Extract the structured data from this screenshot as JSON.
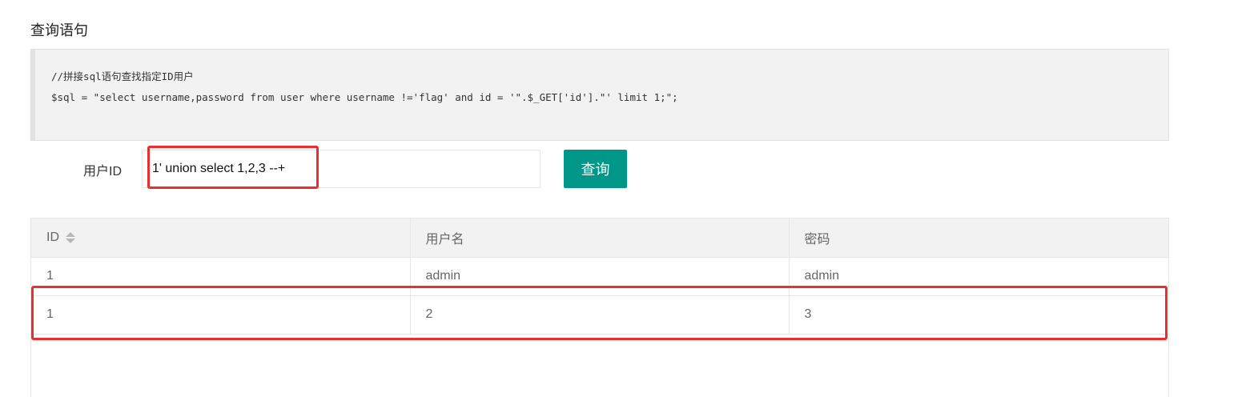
{
  "section": {
    "title": "查询语句"
  },
  "code": {
    "lines": [
      "//拼接sql语句查找指定ID用户",
      "$sql = \"select username,password from user where username !='flag' and id = '\".$_GET['id'].\"' limit 1;\";"
    ]
  },
  "form": {
    "label": "用户ID",
    "input_value": "1' union select 1,2,3 --+",
    "button_label": "查询"
  },
  "table": {
    "columns": [
      "ID",
      "用户名",
      "密码"
    ],
    "rows": [
      [
        "1",
        "admin",
        "admin"
      ],
      [
        "1",
        "2",
        "3"
      ]
    ]
  },
  "colors": {
    "accent": "#009688",
    "highlight": "#ee2e2e"
  },
  "icons": {
    "sort": "sort-caret-icon"
  }
}
